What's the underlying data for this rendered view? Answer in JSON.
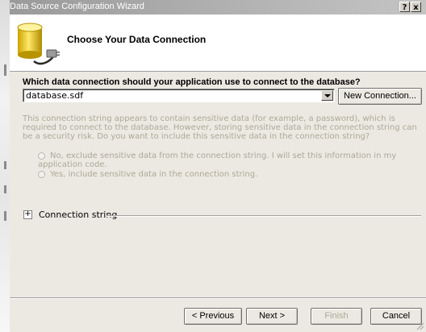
{
  "window": {
    "title": "Data Source Configuration Wizard",
    "help_label": "?",
    "close_label": "x"
  },
  "header": {
    "title": "Choose Your Data Connection",
    "icon": "database-connection-icon"
  },
  "connection": {
    "question": "Which data connection should your application use to connect to the database?",
    "selected": "database.sdf",
    "new_connection_label": "New Connection..."
  },
  "sensitive": {
    "description": "This connection string appears to contain sensitive data (for example, a password), which is required to connect to the database. However, storing sensitive data in the connection string can be a security risk. Do you want to include this sensitive data in the connection string?",
    "option_no": "No, exclude sensitive data from the connection string. I will set this information in my application code.",
    "option_yes": "Yes, include sensitive data in the connection string."
  },
  "connection_string": {
    "expander": "+",
    "label": "Connection string"
  },
  "buttons": {
    "previous": "< Previous",
    "next": "Next >",
    "finish": "Finish",
    "cancel": "Cancel"
  },
  "colors": {
    "window_bg": "#ece9e2",
    "disabled_text": "#aca899",
    "title_bar": "#b4b4b4"
  }
}
